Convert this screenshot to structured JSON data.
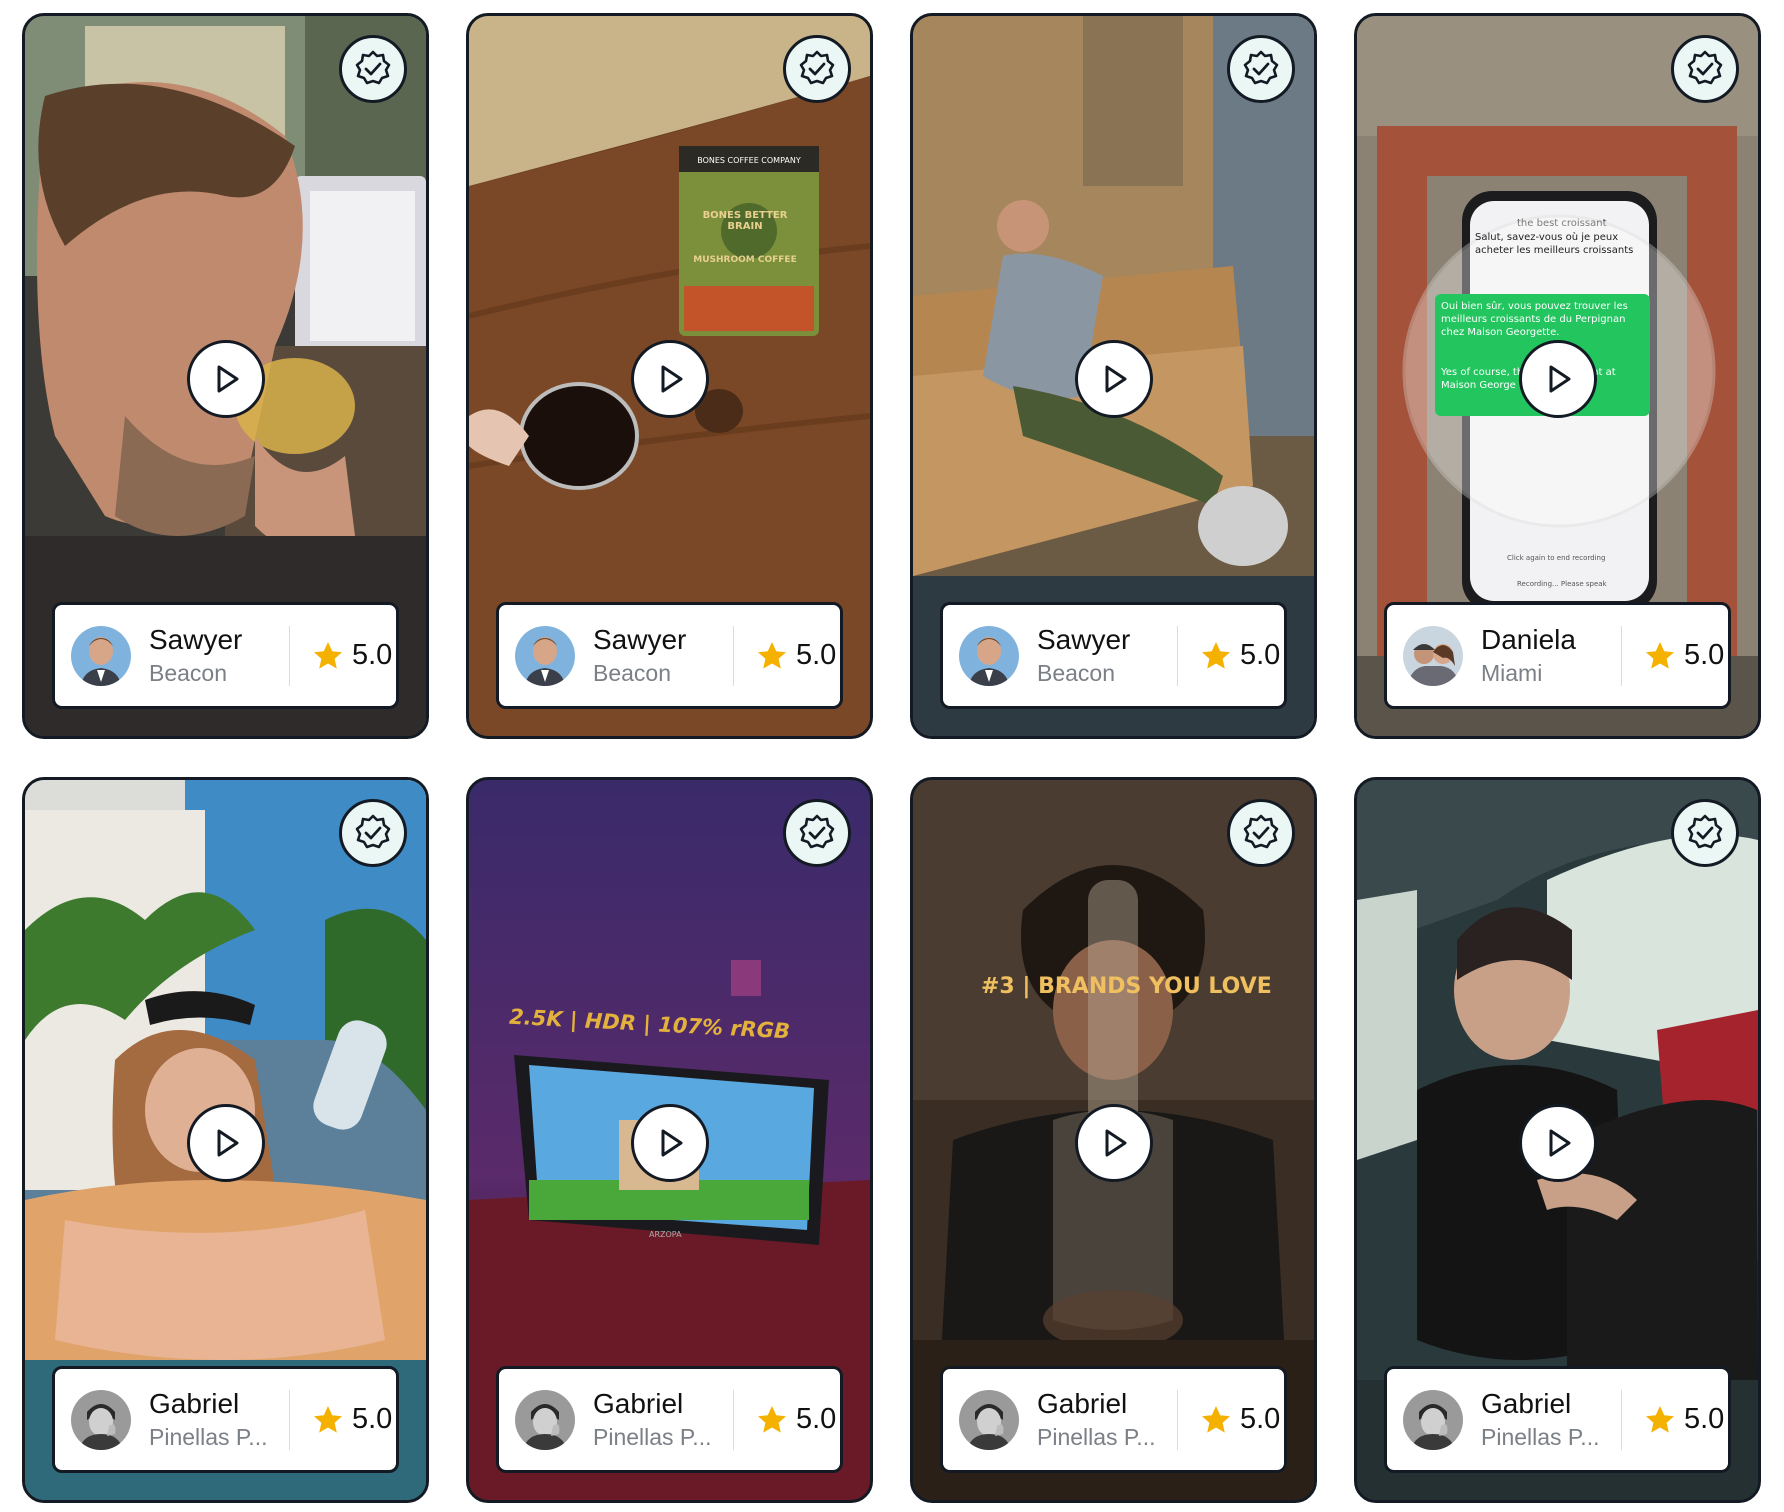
{
  "cards": [
    {
      "name": "Sawyer",
      "location": "Beacon",
      "rating": "5.0",
      "avatar": "man-suit-avatar",
      "scene": "man-drinking-juice"
    },
    {
      "name": "Sawyer",
      "location": "Beacon",
      "rating": "5.0",
      "avatar": "man-suit-avatar",
      "scene": "coffee-bag-on-table"
    },
    {
      "name": "Sawyer",
      "location": "Beacon",
      "rating": "5.0",
      "avatar": "man-suit-avatar",
      "scene": "man-on-sofa"
    },
    {
      "name": "Daniela",
      "location": "Miami",
      "rating": "5.0",
      "avatar": "couple-avatar",
      "scene": "phone-translation-app"
    },
    {
      "name": "Gabriel",
      "location": "Pinellas P...",
      "rating": "5.0",
      "avatar": "man-bw-avatar",
      "scene": "woman-in-pool"
    },
    {
      "name": "Gabriel",
      "location": "Pinellas P...",
      "rating": "5.0",
      "avatar": "man-bw-avatar",
      "scene": "portable-monitor"
    },
    {
      "name": "Gabriel",
      "location": "Pinellas P...",
      "rating": "5.0",
      "avatar": "man-bw-avatar",
      "scene": "man-behind-glass-vase"
    },
    {
      "name": "Gabriel",
      "location": "Pinellas P...",
      "rating": "5.0",
      "avatar": "man-bw-avatar",
      "scene": "woman-in-car"
    }
  ],
  "overlays": {
    "coffee_bag_brand": "BONES COFFEE COMPANY",
    "coffee_bag_title": "BONES BETTER BRAIN",
    "coffee_bag_subtitle": "MUSHROOM COFFEE",
    "phone_header": "the best croissant",
    "phone_msg_1": "Salut, savez-vous où je peux acheter les meilleurs croissants",
    "phone_msg_2": "Oui bien sûr, vous pouvez trouver les meilleurs croissants de du Perpignan chez Maison Georgette.",
    "phone_msg_3": "Yes of course, the best croissant at Maison George",
    "phone_footer_1": "Click again to end recording",
    "phone_footer_2": "Recording... Please speak",
    "monitor_text": "2.5K | HDR | 107% rRGB",
    "monitor_brand": "ARZOPA",
    "brands_text": "#3 | BRANDS YOU LOVE"
  },
  "colors": {
    "border": "#131a24",
    "star": "#f5b100",
    "verified_bg": "#eaf7f5"
  }
}
